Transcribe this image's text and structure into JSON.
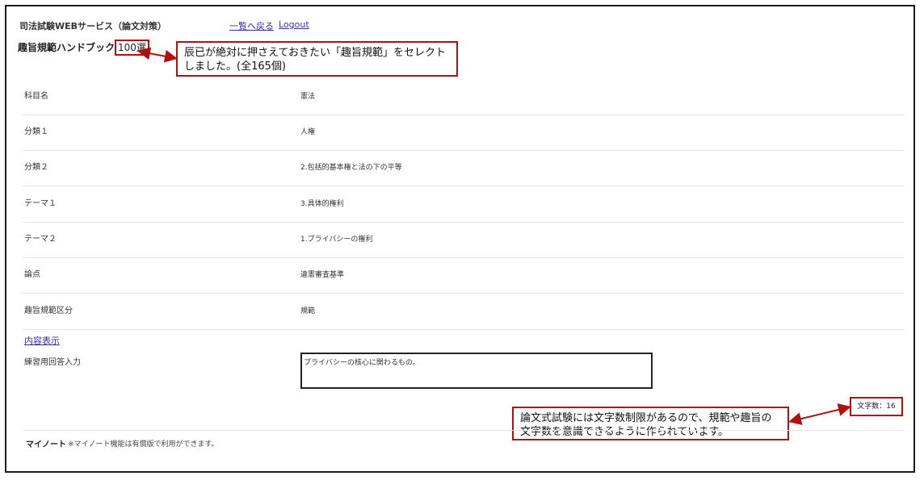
{
  "header": {
    "app_title": "司法試験WEBサービス（論文対策）",
    "back_to_list": "一覧へ戻る",
    "logout": "Logout"
  },
  "book": {
    "title_prefix": "趣旨規範ハンドブック",
    "title_count": "100選"
  },
  "annotations": {
    "callout_top": "辰已が絶対に押さえておきたい「趣旨規範」をセレクトしました。(全165個)",
    "callout_bottom": "論文式試験には文字数制限があるので、規範や趣旨の文字数を意識できるように作られています。",
    "color": "#b01010"
  },
  "fields": [
    {
      "label": "科目名",
      "value": "憲法"
    },
    {
      "label": "分類１",
      "value": "人権"
    },
    {
      "label": "分類２",
      "value": "2.包括的基本権と法の下の平等"
    },
    {
      "label": "テーマ１",
      "value": "3.具体的権利"
    },
    {
      "label": "テーマ２",
      "value": "1.プライバシーの権利"
    },
    {
      "label": "論点",
      "value": "違憲審査基準"
    },
    {
      "label": "趣旨規範区分",
      "value": "規範"
    }
  ],
  "content_display_link": "内容表示",
  "answer": {
    "label": "練習用回答入力",
    "value": "プライバシーの核心に関わるもの。"
  },
  "char_count": "文字数：16",
  "mynote": {
    "label": "マイノート",
    "note": "※マイノート機能は有償版で利用ができます。"
  }
}
